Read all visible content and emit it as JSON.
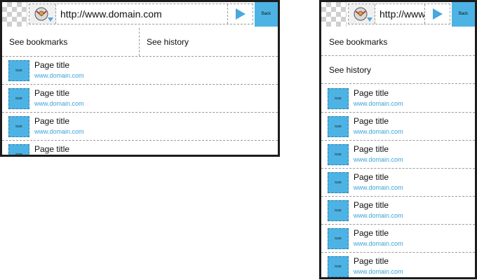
{
  "browser": {
    "url": "http://www.domain.com",
    "url_truncated": "http://www.",
    "back_label": "Back"
  },
  "nav": {
    "bookmarks_label": "See bookmarks",
    "history_label": "See history"
  },
  "colors": {
    "accent": "#4db3e4",
    "link": "#3aa3d8",
    "frame": "#1c1c1c"
  },
  "list_items": [
    {
      "icon_label": "icon",
      "title": "Page title",
      "url": "www.domain.com"
    },
    {
      "icon_label": "icon",
      "title": "Page title",
      "url": "www.domain.com"
    },
    {
      "icon_label": "icon",
      "title": "Page title",
      "url": "www.domain.com"
    },
    {
      "icon_label": "icon",
      "title": "Page title",
      "url": "www.domain.com"
    },
    {
      "icon_label": "icon",
      "title": "Page title",
      "url": "www.domain.com"
    },
    {
      "icon_label": "icon",
      "title": "Page title",
      "url": "www.domain.com"
    },
    {
      "icon_label": "icon",
      "title": "Page title",
      "url": "www.domain.com"
    }
  ]
}
